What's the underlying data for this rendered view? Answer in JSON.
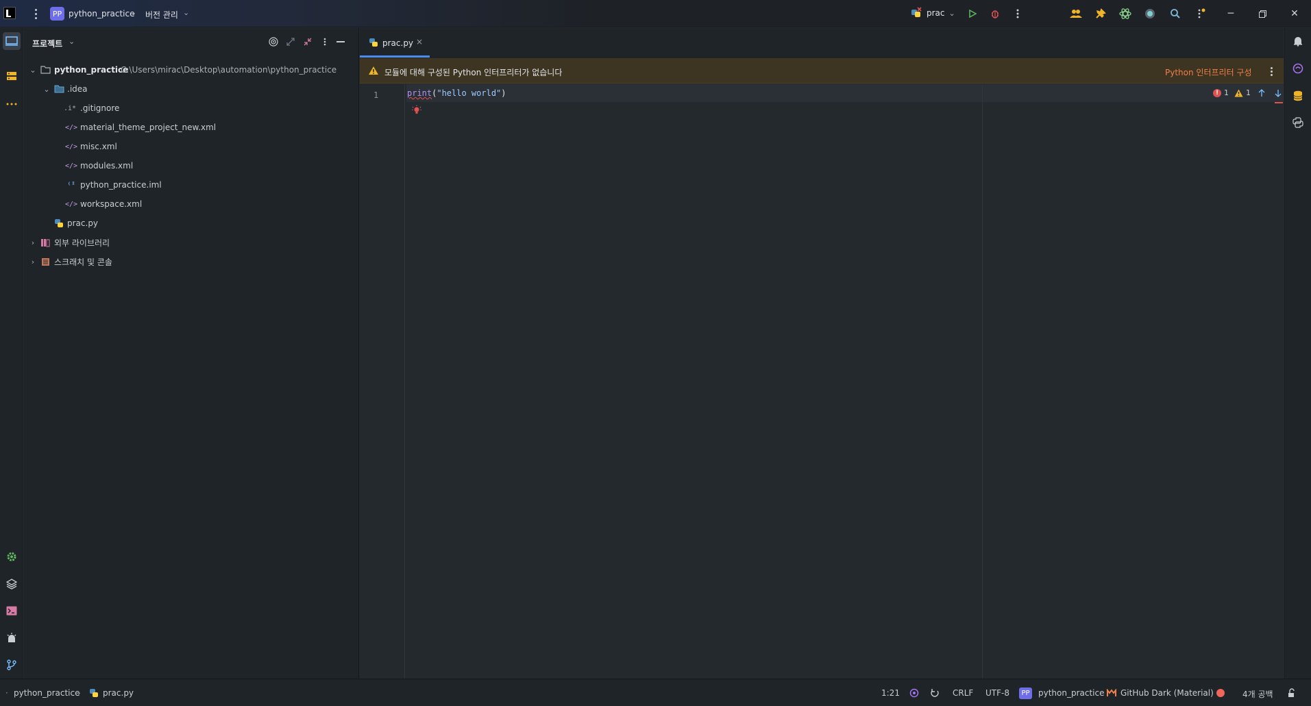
{
  "titlebar": {
    "project_badge": "PP",
    "project_name": "python_practice",
    "vcs_label": "버전 관리",
    "run_config": "prac"
  },
  "project_panel": {
    "title": "프로젝트",
    "tree": [
      {
        "label": "python_practice",
        "path": "C:\\Users\\mirac\\Desktop\\automation\\python_practice",
        "icon": "folder-icon",
        "expanded": true
      },
      {
        "label": ".idea",
        "icon": "folder-icon",
        "expanded": true
      },
      {
        "label": ".gitignore",
        "icon": "gitignore-icon"
      },
      {
        "label": "material_theme_project_new.xml",
        "icon": "xml-icon"
      },
      {
        "label": "misc.xml",
        "icon": "xml-icon"
      },
      {
        "label": "modules.xml",
        "icon": "xml-icon"
      },
      {
        "label": "python_practice.iml",
        "icon": "iml-icon"
      },
      {
        "label": "workspace.xml",
        "icon": "xml-icon"
      },
      {
        "label": "prac.py",
        "icon": "python-file-icon"
      },
      {
        "label": "외부 라이브러리",
        "icon": "library-icon",
        "expanded": false
      },
      {
        "label": "스크래치 및 콘솔",
        "icon": "scratch-icon",
        "expanded": false
      }
    ]
  },
  "editor": {
    "tab_label": "prac.py",
    "tab_close": "×",
    "banner_text": "모듈에 대해 구성된 Python 인터프리터가 없습니다",
    "banner_link": "Python 인터프리터 구성",
    "line_number": "1",
    "code": {
      "fn": "print",
      "open": "(",
      "str": "\"hello world\"",
      "close": ")"
    },
    "errors": "1",
    "warnings": "1"
  },
  "status_bar": {
    "crumb_project": "python_practice",
    "crumb_file": "prac.py",
    "position": "1:21",
    "line_ending": "CRLF",
    "encoding": "UTF-8",
    "interpreter_badge": "PP",
    "interpreter": "python_practice",
    "theme": "GitHub Dark (Material)",
    "indent": "4개 공백"
  },
  "colors": {
    "accent": "#4a8cf0",
    "warning_banner": "#3d3421",
    "link": "#f0804a",
    "error": "#e05252",
    "badge": "#6d6ee8"
  }
}
